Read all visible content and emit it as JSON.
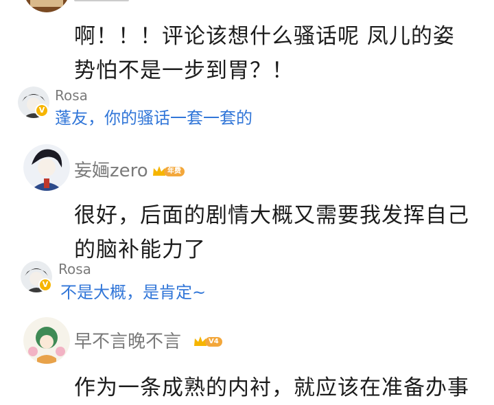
{
  "comments": [
    {
      "body": "啊！！！评论该想什么骚话呢 凤儿的姿势怕不是一步到胃？！",
      "reply": {
        "username": "Rosa",
        "text": "蓬友，你的骚话一套一套的",
        "badge": "V"
      }
    },
    {
      "username": "妄婳zero",
      "badge": {
        "level": "年费"
      },
      "body": "很好，后面的剧情大概又需要我发挥自己的脑补能力了",
      "reply": {
        "username": "Rosa",
        "text": "不是大概，是肯定~",
        "badge": "V"
      }
    },
    {
      "username": "早不言晚不言",
      "badge": {
        "level": "V4"
      },
      "body": "作为一条成熟的内衬，就应该在准备办事"
    }
  ],
  "colors": {
    "username": "#7a7a7a",
    "reply_link": "#3176d8",
    "body": "#1c1c1c",
    "badge": "#f3a73b"
  }
}
